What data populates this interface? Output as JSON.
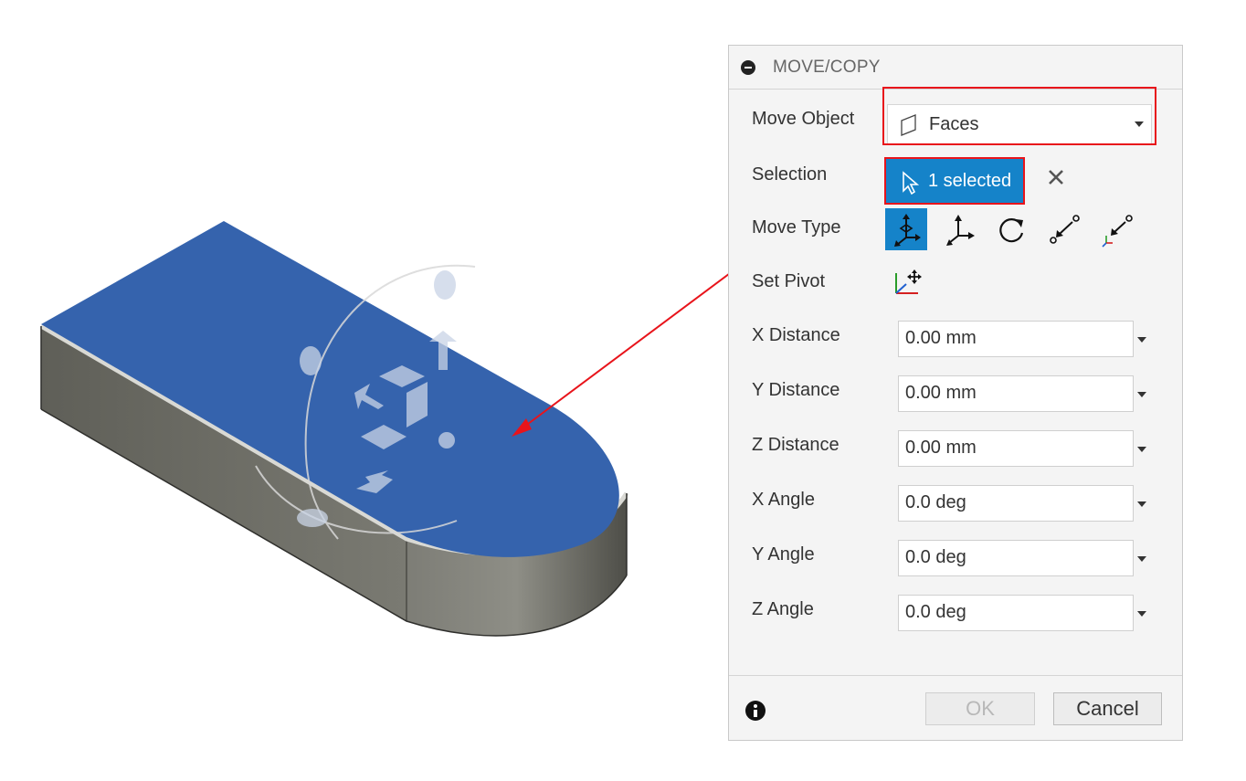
{
  "dialog": {
    "title": "MOVE/COPY",
    "move_object": {
      "label": "Move Object",
      "value": "Faces"
    },
    "selection": {
      "label": "Selection",
      "value": "1 selected"
    },
    "move_type": {
      "label": "Move Type",
      "options": [
        "free-move-icon",
        "translate-xyz-icon",
        "rotate-icon",
        "point-to-point-icon",
        "point-to-position-icon"
      ],
      "active_index": 0
    },
    "set_pivot": {
      "label": "Set Pivot"
    },
    "fields": [
      {
        "label": "X Distance",
        "value": "0.00 mm"
      },
      {
        "label": "Y Distance",
        "value": "0.00 mm"
      },
      {
        "label": "Z Distance",
        "value": "0.00 mm"
      },
      {
        "label": "X Angle",
        "value": "0.0 deg"
      },
      {
        "label": "Y Angle",
        "value": "0.0 deg"
      },
      {
        "label": "Z Angle",
        "value": "0.0 deg"
      }
    ],
    "ok_label": "OK",
    "cancel_label": "Cancel"
  },
  "colors": {
    "accent": "#1583c9",
    "highlight": "#e8141b",
    "face_selected": "#3563ad",
    "body_gray": "#6f6f66"
  }
}
